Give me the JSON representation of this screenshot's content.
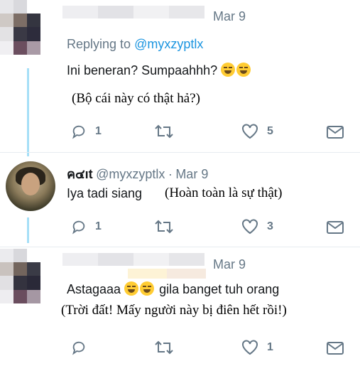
{
  "tweets": [
    {
      "date": "Mar 9",
      "replying_prefix": "Replying to ",
      "replying_handle": "@myxzyptlx",
      "text": "Ini beneran? Sumpaahhh?",
      "emoji": [
        "rofl-emoji",
        "rofl-emoji"
      ],
      "translation": "(Bộ cái này có thật hả?)",
      "actions": {
        "reply_count": "1",
        "retweet_count": "",
        "like_count": "5"
      }
    },
    {
      "name": "ค๔ıt",
      "handle": "@myxzyptlx",
      "dot": "·",
      "date": "Mar 9",
      "text": "Iya tadi siang",
      "translation": "(Hoàn toàn là sự thật)",
      "actions": {
        "reply_count": "1",
        "retweet_count": "",
        "like_count": "3"
      }
    },
    {
      "date": "Mar 9",
      "text_before": "Astagaaa",
      "emoji": [
        "joy-emoji",
        "joy-emoji"
      ],
      "text_after": "gila banget tuh orang",
      "translation": "(Trời đất! Mấy người này bị điên hết rồi!)",
      "actions": {
        "reply_count": "",
        "retweet_count": "",
        "like_count": "1"
      }
    }
  ],
  "colors": {
    "accent": "#1b95e0",
    "muted": "#657786",
    "thread_line": "#a6dff7"
  }
}
